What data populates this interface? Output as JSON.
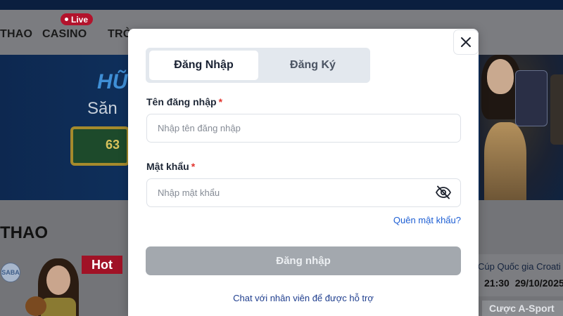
{
  "background": {
    "nav": {
      "items": [
        "THAO",
        "CASINO",
        "TRÒ"
      ],
      "live_badge": "Live"
    },
    "banner": {
      "title": "HŨ",
      "subtitle": "Săn",
      "box_number": "63"
    },
    "section_title": "THAO",
    "promo": {
      "hot_tag": "Hot",
      "provider_badge": "SABA"
    },
    "match": {
      "title": "Cúp Quốc gia Croati",
      "time": "21:30",
      "date": "29/10/2025",
      "tab": "Cược A-Sport"
    }
  },
  "modal": {
    "tabs": {
      "login": "Đăng Nhập",
      "register": "Đăng Ký"
    },
    "username": {
      "label": "Tên đăng nhập",
      "required_mark": "*",
      "placeholder": "Nhập tên đăng nhập",
      "value": ""
    },
    "password": {
      "label": "Mật khẩu",
      "required_mark": "*",
      "placeholder": "Nhập mật khẩu",
      "value": ""
    },
    "forgot_password": "Quên mật khẩu?",
    "submit_label": "Đăng nhập",
    "support_link": "Chat với nhân viên để được hỗ trợ"
  },
  "colors": {
    "accent_link": "#1e5fd4",
    "live_badge": "#b3132c",
    "hot_tag": "#a01226",
    "disabled_button": "#a3a8ae"
  },
  "icons": [
    "close-icon",
    "eye-off-icon",
    "live-dot-icon"
  ]
}
